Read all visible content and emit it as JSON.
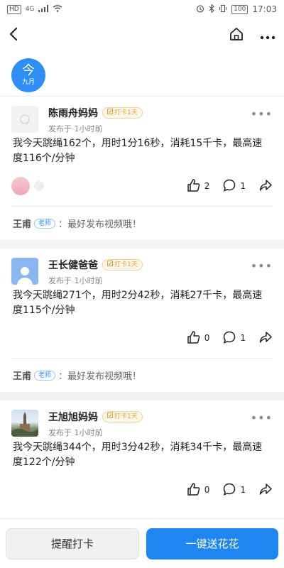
{
  "status_bar": {
    "hd": "HD",
    "signal": "4G",
    "battery": "100",
    "time": "17:03"
  },
  "nav": {
    "back_icon": "chevron-left-icon",
    "home_icon": "home-icon",
    "more_icon": "more-dots-icon"
  },
  "date_badge": {
    "day": "今",
    "month": "九月"
  },
  "posts": [
    {
      "author": "陈雨舟妈妈",
      "tag": "打卡1天",
      "time": "发布于 1小时前",
      "content": "我今天跳绳162个，用时1分16秒，消耗15千卡，最高速度116个/分钟",
      "likes": "2",
      "comments": "1",
      "comment": {
        "name": "王甫",
        "role": "老师",
        "text": "：最好发布视频哦！"
      }
    },
    {
      "author": "王长健爸爸",
      "tag": "打卡1天",
      "time": "发布于 1小时前",
      "content": "我今天跳绳271个，用时2分42秒，消耗27千卡，最高速度115个/分钟",
      "likes": "0",
      "comments": "1",
      "comment": {
        "name": "王甫",
        "role": "老师",
        "text": "：最好发布视频哦！"
      }
    },
    {
      "author": "王旭旭妈妈",
      "tag": "打卡1天",
      "time": "发布于 1小时前",
      "content": "我今天跳绳344个，用时3分42秒，消耗34千卡，最高速度122个/分钟",
      "likes": "0",
      "comments": "1"
    }
  ],
  "bottom": {
    "remind": "提醒打卡",
    "send_flowers": "一键送花花"
  },
  "colors": {
    "accent": "#1e86f0",
    "tag_gold": "#d9a23a",
    "teacher_blue": "#2e8ef5"
  }
}
